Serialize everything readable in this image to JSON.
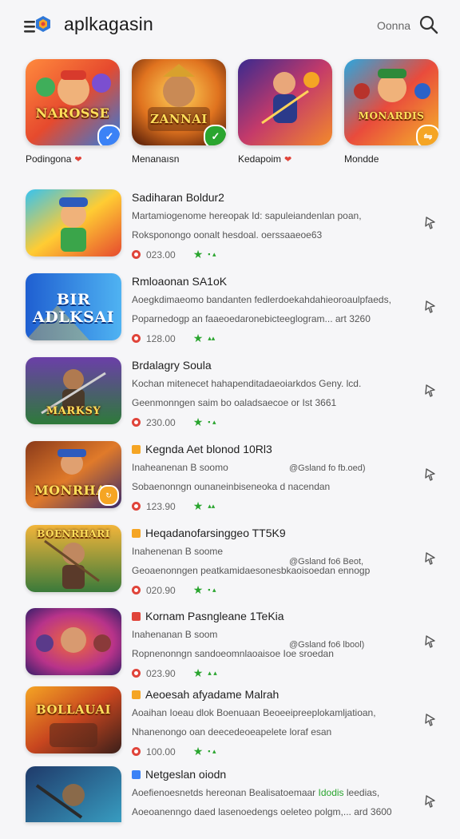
{
  "header": {
    "title": "aplkagasin",
    "link": "Oonna"
  },
  "featured": [
    {
      "label": "Podingona",
      "thumb_title": "NAROSSE",
      "badge": "✓",
      "badge_color": "#3b82f6",
      "heart": true
    },
    {
      "label": "Menanaısn",
      "thumb_title": "ZANNAI",
      "badge": "✓",
      "badge_color": "#2aa52f",
      "heart": false
    },
    {
      "label": "Kedapoim",
      "thumb_title": "",
      "badge": "",
      "badge_color": "",
      "heart": true
    },
    {
      "label": "Mondde",
      "thumb_title": "MONARDIS",
      "badge": "⇋",
      "badge_color": "#f5a524",
      "heart": false
    }
  ],
  "list": [
    {
      "title": "Sadiharan Boldur2",
      "desc": "Martamiogenome hereopak Id: sapuleiandenlan poan,",
      "desc2": "Roksponongo oonalt hesdoal. oerssaaeoe63",
      "aside": "",
      "size": "023.00",
      "thumb_title": "",
      "tag_color": ""
    },
    {
      "title": "Rmloaonan SA1oK",
      "desc": "Aoegkdimaeomo bandanten fedlerdoekahdahieoroaulpfaeds,",
      "desc2": "Poparnedogp an faaeoedaronebicteeglogram... art 3260",
      "aside": "",
      "size": "128.00",
      "thumb_title": "BIR ADLKSAI",
      "tag_color": ""
    },
    {
      "title": "Brdalagry Soula",
      "desc": "Kochan mitenecet hahapenditadaeoiarkdos Geny. lcd.",
      "desc2": "Geenmonngen saim bo oaladsaecoe or Ist 3661",
      "aside": "",
      "size": "230.00",
      "thumb_title": "MARKSY",
      "tag_color": ""
    },
    {
      "title": "Kegnda Aet blonod 10Rl3",
      "desc": "Inaheanenan B soomo",
      "desc2": "Sobaenonngn ounaneinbiseneoka d nacendan",
      "aside": "@Gsland fo fb.oed)",
      "size": "123.90",
      "thumb_title": "MONRHAI",
      "tag_color": "#f5a524"
    },
    {
      "title": "Heqadanofarsinggeo TT5K9",
      "desc": "Inahenenan B soome",
      "desc2": "Geoaenonngen peatkamidaesonesbkaoisoedan ennogp",
      "aside": "@Gsland fo6 Beot,",
      "size": "020.90",
      "thumb_title": "BOENRHARI",
      "tag_color": "#f5a524"
    },
    {
      "title": "Kornam Pasngleane 1TeKia",
      "desc": "Inahenanan B soom",
      "desc2": "Ropnenonngn sandoeomnlaoaisoe Ioe sroedan",
      "aside": "@Gsland fo6 lbool)",
      "size": "023.90",
      "thumb_title": "",
      "tag_color": "#e0443a"
    },
    {
      "title": "Aeoesah afyadame Malrah",
      "desc": "Aoaihan Ioeau dlok Boenuaan Beoeeipreeplokamljatioan,",
      "desc2": "Nhanenongo oan deecedeoeapelete loraf esan",
      "aside": "",
      "size": "100.00",
      "thumb_title": "BOLLAUAI",
      "tag_color": "#f5a524"
    },
    {
      "title": "Netgeslan oiodn",
      "desc": "Aoefienoesnetds hereonan Bealisatoemaar",
      "desc_green": "Idodis",
      "desc_tail": "leedias,",
      "desc2": "Aoeoanenngo daed lasenoedengs oeleteo polgm,... ard 3600",
      "aside": "",
      "size": "",
      "thumb_title": "",
      "tag_color": "#3b82f6"
    }
  ],
  "colors": {
    "accent_green": "#2aa52f",
    "download_red": "#e0443a",
    "badge_orange": "#f5a524",
    "badge_blue": "#3b82f6"
  },
  "icons": {
    "menu": "menu-icon",
    "search": "search-icon",
    "pin": "pin-icon",
    "download": "download-icon",
    "star": "star-icon"
  }
}
